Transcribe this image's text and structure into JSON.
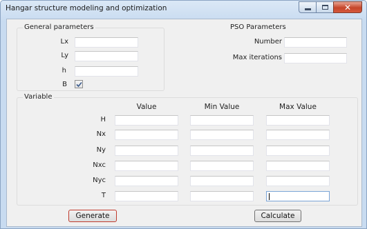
{
  "window": {
    "title": "Hangar structure modeling and optimization",
    "close_glyph": "✕"
  },
  "general": {
    "legend": "General parameters",
    "lx_label": "Lx",
    "ly_label": "Ly",
    "h_label": "h",
    "b_label": "B",
    "b_checked": true,
    "lx_value": "",
    "ly_value": "",
    "h_value": ""
  },
  "pso": {
    "legend": "PSO Parameters",
    "number_label": "Number",
    "max_iter_label": "Max iterations",
    "number_value": "",
    "max_iter_value": ""
  },
  "variable": {
    "legend": "Variable",
    "col_value": "Value",
    "col_min": "Min Value",
    "col_max": "Max Value",
    "rows": [
      {
        "label": "H"
      },
      {
        "label": "Nx"
      },
      {
        "label": "Ny"
      },
      {
        "label": "Nxc"
      },
      {
        "label": "Nyc"
      },
      {
        "label": "T"
      }
    ]
  },
  "buttons": {
    "generate": "Generate",
    "calculate": "Calculate"
  },
  "icons": {
    "minimize": "minimize-icon",
    "maximize": "maximize-icon",
    "close": "close-icon",
    "check": "checkmark-icon"
  }
}
